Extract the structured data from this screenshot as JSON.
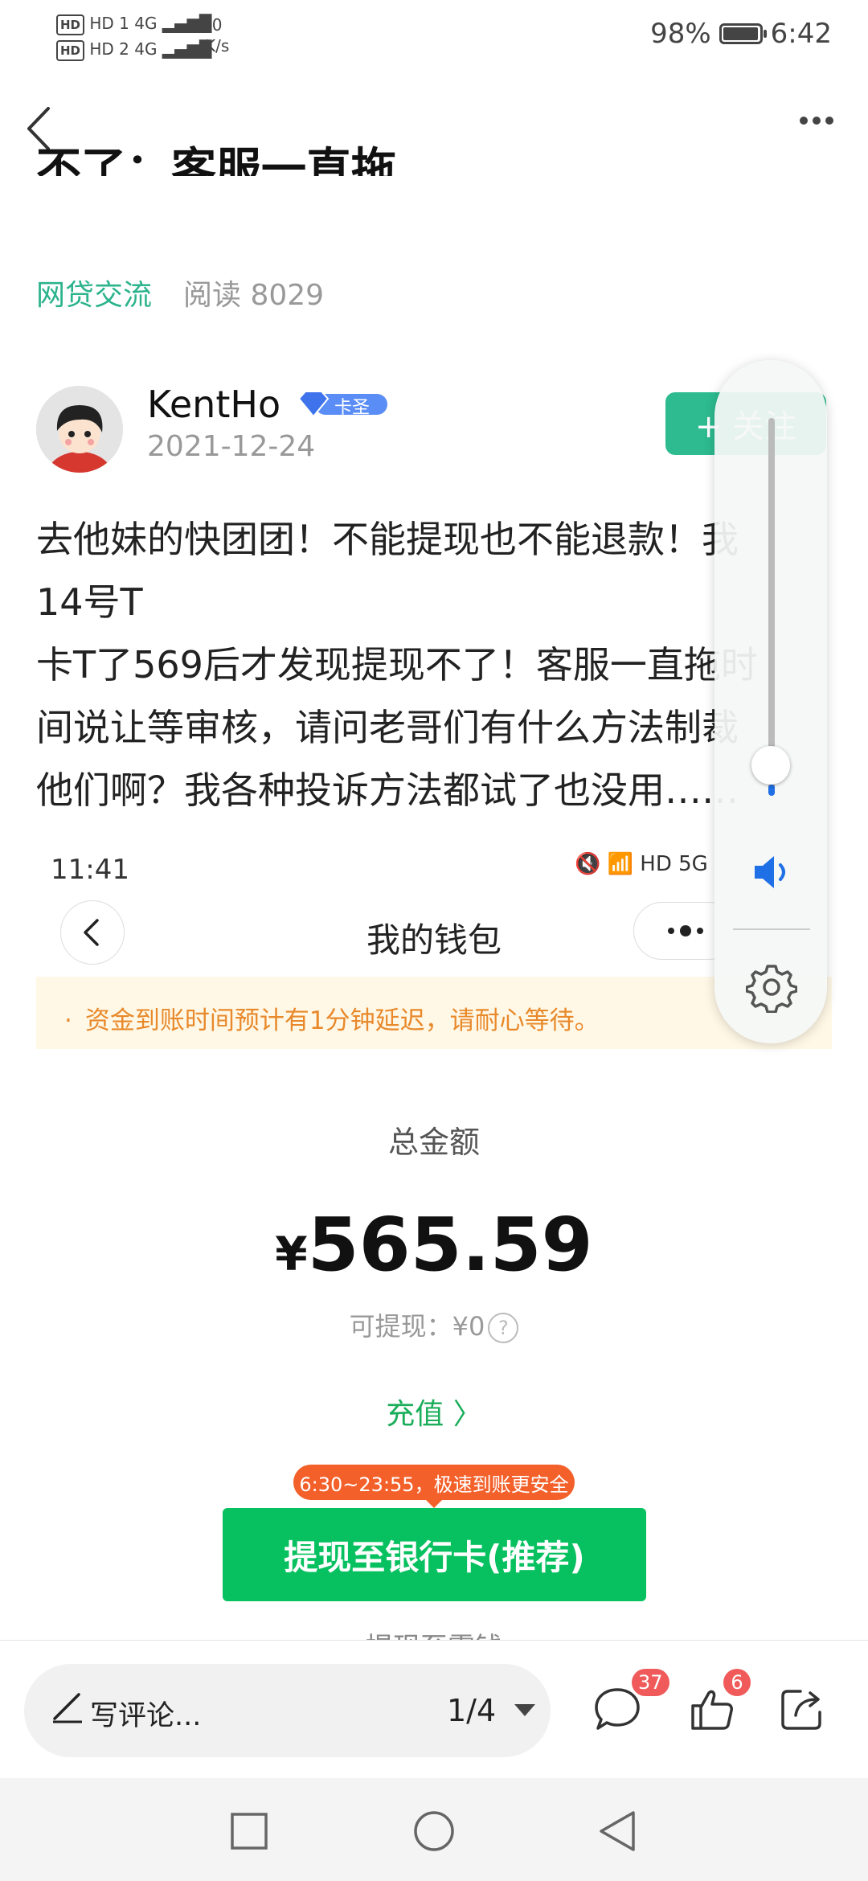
{
  "status_bar": {
    "network_1": "HD 1 4G",
    "network_2": "HD 2 4G",
    "speed_value": "0",
    "speed_unit": "K/s",
    "battery": "98%",
    "battery_level": 0.98,
    "time": "6:42"
  },
  "post": {
    "title_partial": "不了：客服一直拖",
    "tag": "网贷交流",
    "reads": "阅读 8029",
    "author": "KentHo",
    "badge": "卡圣",
    "date": "2021-12-24",
    "follow": "+ 关注",
    "body_lines": [
      "去他妹的快团团！不能提现也不能退款！我",
      "14号T",
      "卡T了569后才发现提现不了！客服一直拖时",
      "间说让等审核，请问老哥们有什么方法制裁",
      "他们啊？我各种投诉方法都试了也没用……"
    ]
  },
  "embedded": {
    "time": "11:41",
    "status_icons": "HD 5G",
    "title": "我的钱包",
    "notice": "资金到账时间预计有1分钟延迟，请耐心等待。",
    "total_label": "总金额",
    "currency": "¥",
    "amount": "565.59",
    "available": "可提现：¥0",
    "recharge": "充值 〉",
    "promo": "6:30~23:55，极速到账更安全",
    "withdraw_bank": "提现至银行卡(推荐)",
    "withdraw_change": "提现至零钱"
  },
  "volume": {
    "level": 0.03
  },
  "bottom_bar": {
    "comment_placeholder": "写评论...",
    "page": "1/4",
    "comment_count": "37",
    "like_count": "6"
  },
  "colors": {
    "accent_green": "#2dbb8f",
    "wechat_green": "#07c160",
    "notice_orange": "#e8892b",
    "badge_red": "#f05a5a"
  }
}
